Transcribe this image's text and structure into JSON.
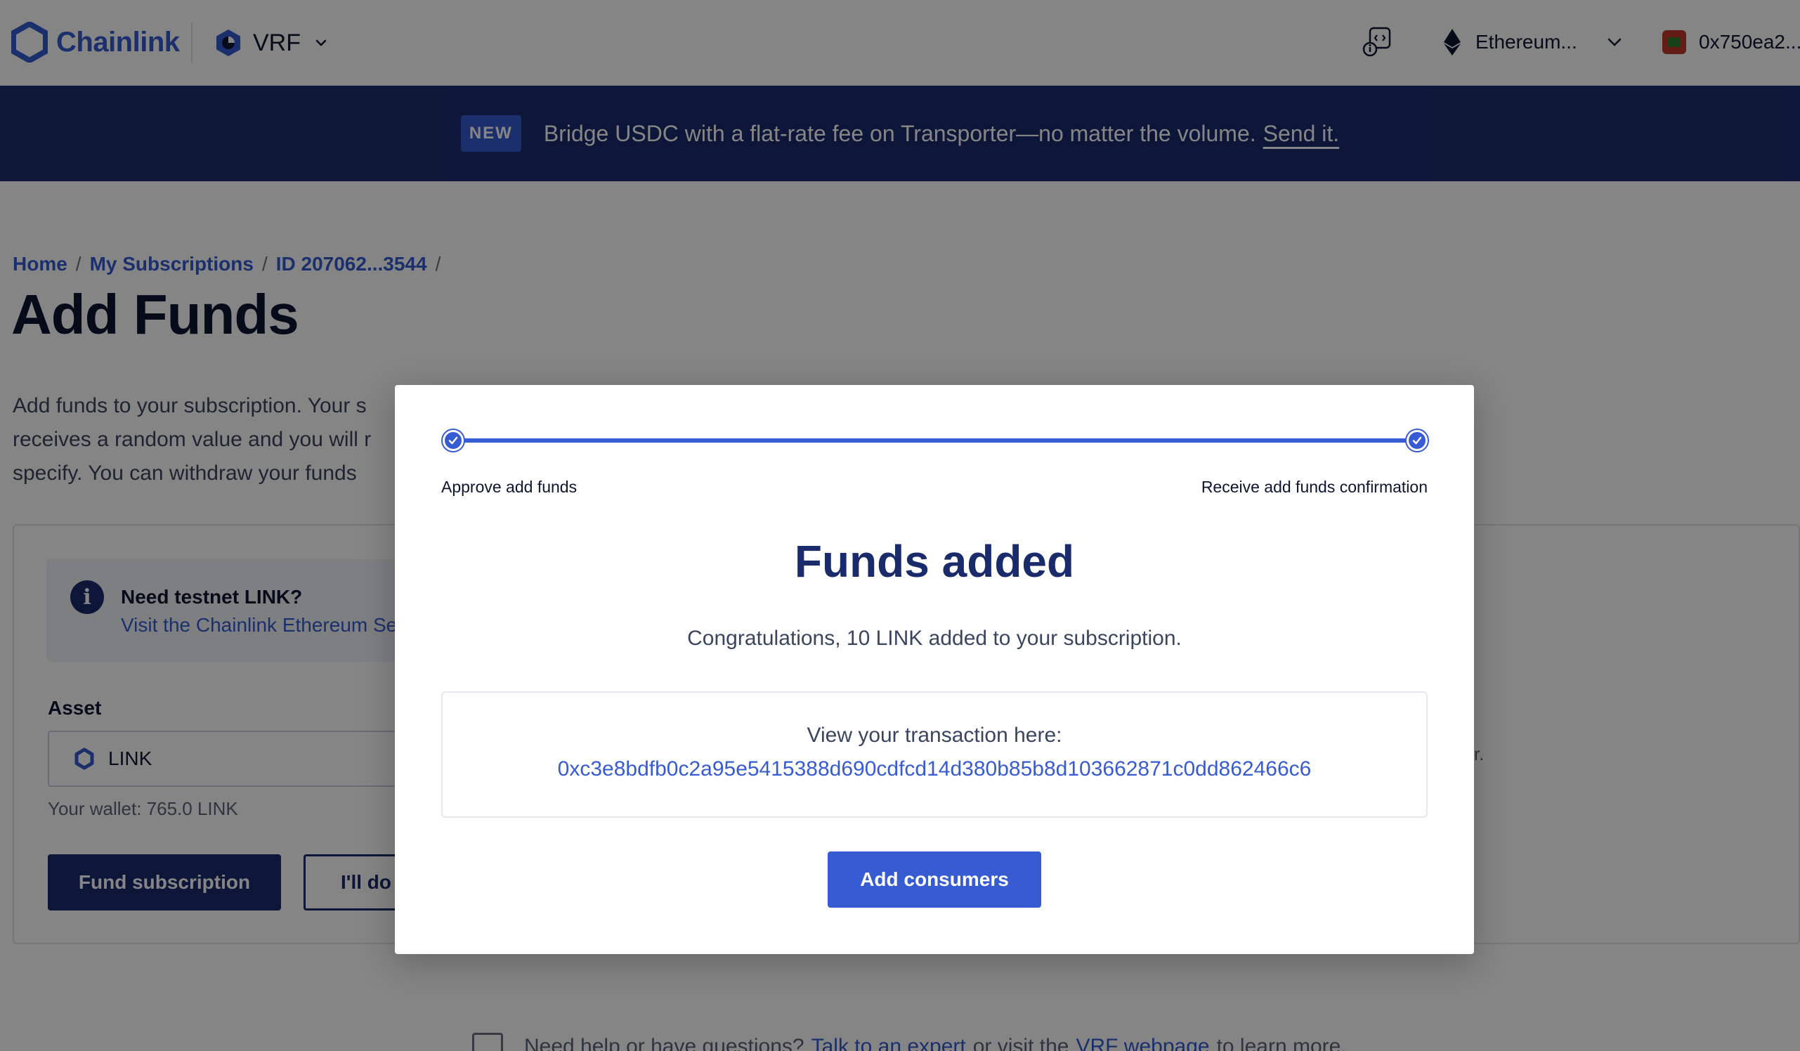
{
  "header": {
    "brand": "Chainlink",
    "product": "VRF",
    "network": "Ethereum...",
    "wallet_address": "0x750ea2..."
  },
  "banner": {
    "badge": "NEW",
    "text": "Bridge USDC with a flat-rate fee on Transporter—no matter the volume.",
    "link": "Send it."
  },
  "breadcrumb": {
    "items": [
      "Home",
      "My Subscriptions",
      "ID 207062...3544"
    ],
    "separator": "/"
  },
  "page": {
    "title": "Add Funds",
    "description_lines": [
      "Add funds to your subscription. Your s",
      "receives a random value and you will r",
      "specify. You can withdraw your funds"
    ]
  },
  "info": {
    "title": "Need testnet LINK?",
    "link": "Visit the Chainlink Ethereum Se"
  },
  "form": {
    "asset_label": "Asset",
    "asset_value": "LINK",
    "wallet_balance": "Your wallet: 765.0 LINK",
    "fund_button": "Fund subscription",
    "later_button": "I'll do",
    "side_note": "later."
  },
  "help": {
    "prefix": "Need help or have questions?",
    "link1": "Talk to an expert",
    "middle": "or visit the",
    "link2": "VRF webpage",
    "suffix": "to learn more."
  },
  "modal": {
    "steps": [
      "Approve add funds",
      "Receive add funds confirmation"
    ],
    "progress": 1.0,
    "title": "Funds added",
    "message": "Congratulations, 10 LINK added to your subscription.",
    "tx_label": "View your transaction here:",
    "tx_hash": "0xc3e8bdfb0c2a95e5415388d690cdfcd14d380b85b8d103662871c0dd862466c6",
    "button": "Add consumers"
  },
  "colors": {
    "brand": "#375bd2",
    "navy": "#1a2b6b",
    "overlay": "rgba(0,0,0,0.48)"
  }
}
